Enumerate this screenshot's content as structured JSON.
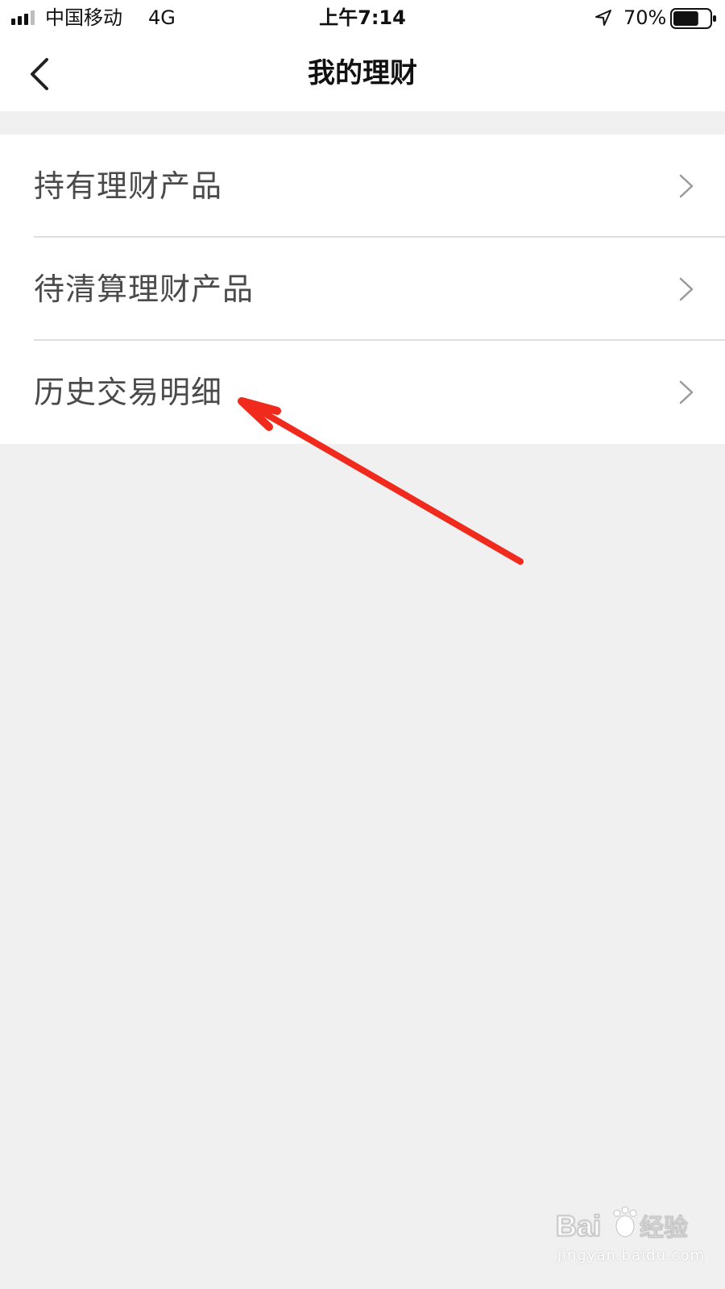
{
  "status_bar": {
    "carrier": "中国移动",
    "network": "4G",
    "time": "上午7:14",
    "battery": "70%",
    "battery_level": 0.7
  },
  "nav": {
    "title": "我的理财",
    "back_icon": "chevron-left-icon"
  },
  "menu": {
    "items": [
      {
        "label": "持有理财产品",
        "icon": "chevron-right-icon"
      },
      {
        "label": "待清算理财产品",
        "icon": "chevron-right-icon"
      },
      {
        "label": "历史交易明细",
        "icon": "chevron-right-icon"
      }
    ]
  },
  "colors": {
    "background": "#f0f0f0",
    "surface": "#ffffff",
    "text": "#4a4a4a",
    "divider": "#dedede",
    "annotation": "#f02a1c"
  },
  "watermark": {
    "logo": "Bai经验",
    "url": "jingyan.baidu.com"
  }
}
